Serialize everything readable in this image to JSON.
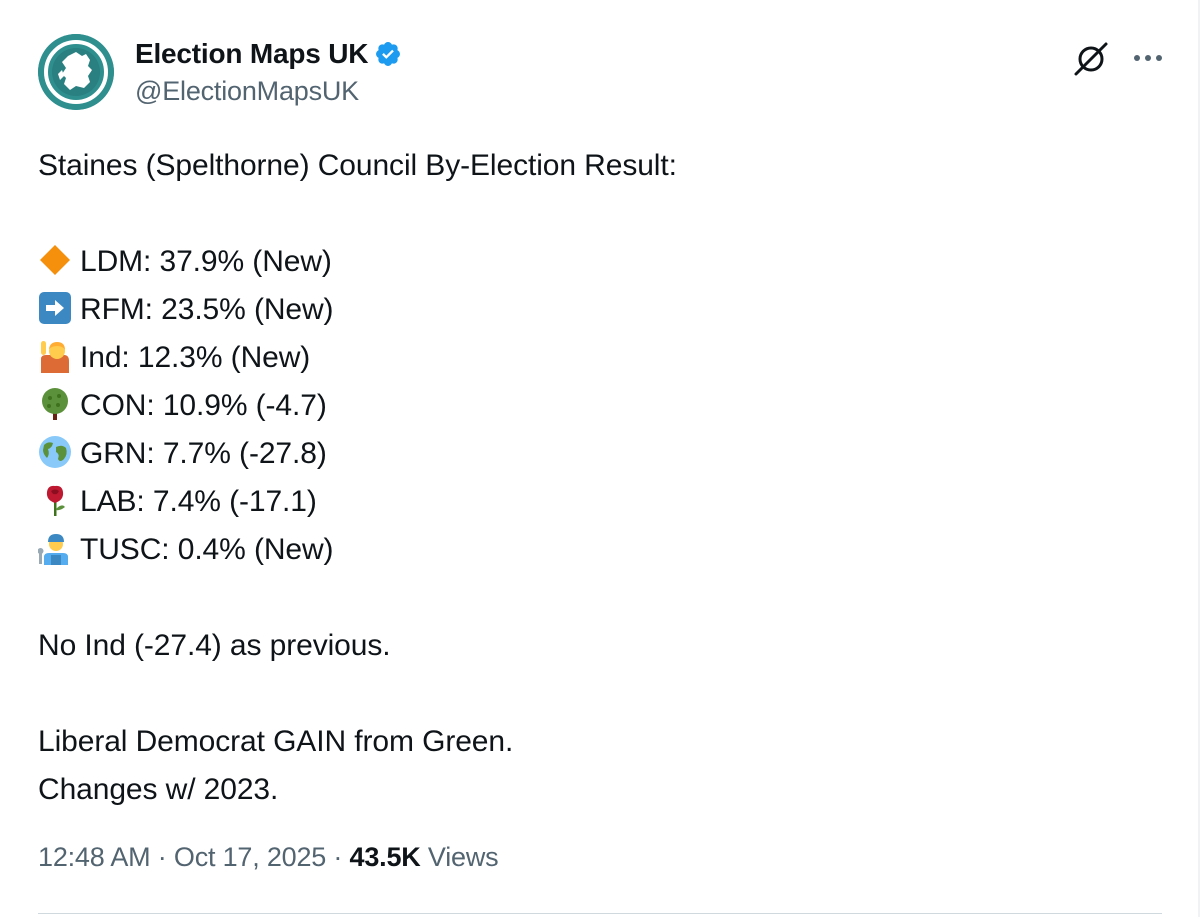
{
  "author": {
    "display_name": "Election Maps UK",
    "handle": "@ElectionMapsUK",
    "verified": true,
    "avatar_icon": "uk-map-logo",
    "brand_color": "#2f8f8f"
  },
  "header_actions": {
    "grok_icon": "grok-icon",
    "more_icon": "more-horizontal-icon"
  },
  "tweet": {
    "title": "Staines (Spelthorne) Council By-Election Result:",
    "results": [
      {
        "emoji": "orange-diamond",
        "text": "LDM: 37.9% (New)"
      },
      {
        "emoji": "right-arrow",
        "text": "RFM: 23.5% (New)"
      },
      {
        "emoji": "person-raising-hand",
        "text": "Ind: 12.3% (New)"
      },
      {
        "emoji": "tree",
        "text": "CON: 10.9% (-4.7)"
      },
      {
        "emoji": "globe",
        "text": "GRN: 7.7% (-27.8)"
      },
      {
        "emoji": "rose",
        "text": "LAB: 7.4% (-17.1)"
      },
      {
        "emoji": "mechanic",
        "text": "TUSC: 0.4% (New)"
      }
    ],
    "note": "No Ind (-27.4) as previous.",
    "summary_line1": "Liberal Democrat GAIN from Green.",
    "summary_line2": "Changes w/ 2023."
  },
  "meta": {
    "time": "12:48 AM",
    "separator": " · ",
    "date": "Oct 17, 2025",
    "views_count": "43.5K",
    "views_label": "Views"
  },
  "colors": {
    "text_primary": "#0f1419",
    "text_secondary": "#536471",
    "verified_blue": "#1d9bf0",
    "divider": "#cfd9de"
  }
}
